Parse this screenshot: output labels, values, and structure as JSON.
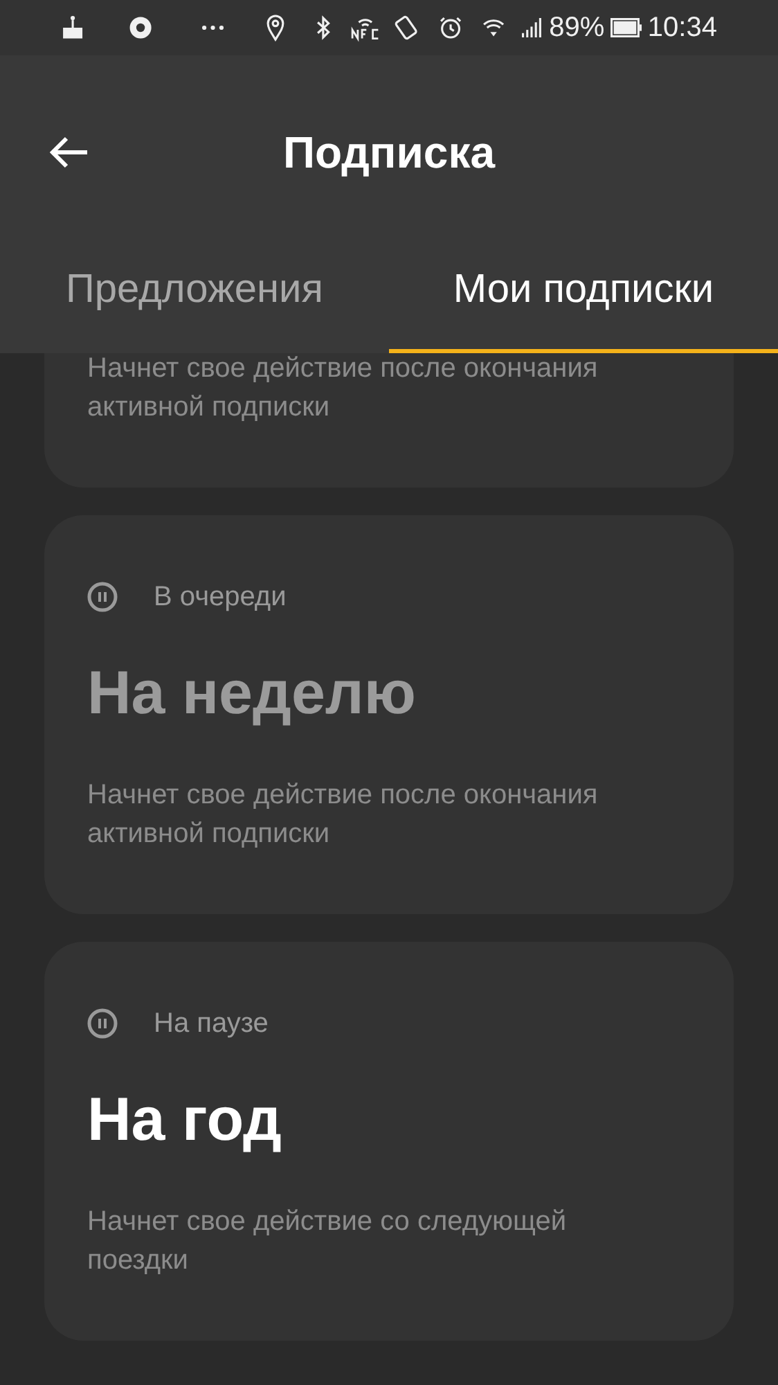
{
  "status_bar": {
    "battery": "89%",
    "time": "10:34"
  },
  "app_bar": {
    "title": "Подписка"
  },
  "tabs": [
    {
      "label": "Предложения",
      "selected": false
    },
    {
      "label": "Мои подписки",
      "selected": true
    }
  ],
  "subscriptions": [
    {
      "kind": "partial",
      "description": "Начнет свое действие после окончания активной подписки"
    },
    {
      "kind": "full",
      "status": "В очереди",
      "title": "На неделю",
      "dimmed": true,
      "description": "Начнет свое действие после окончания активной подписки"
    },
    {
      "kind": "full",
      "status": "На паузе",
      "title": "На год",
      "dimmed": false,
      "description": "Начнет свое действие со следующей поездки"
    }
  ]
}
